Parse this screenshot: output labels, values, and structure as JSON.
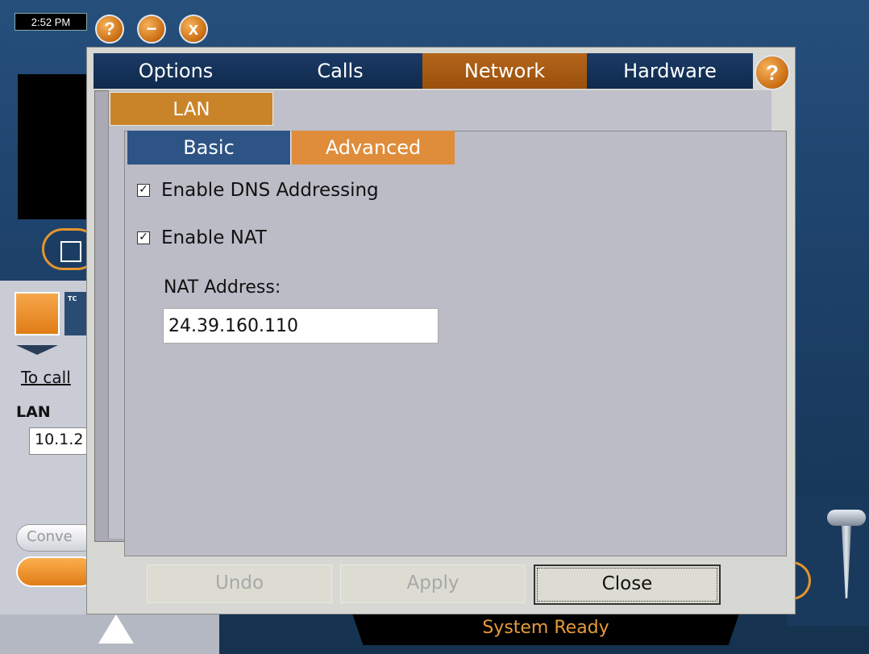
{
  "clock": "2:52 PM",
  "window_controls": {
    "help": "?",
    "minimize": "−",
    "close": "x"
  },
  "background": {
    "icon_tc": "TC",
    "to_call": "To call",
    "lan_label": "LAN",
    "ip_value": "10.1.2",
    "conve_btn": "Conve",
    "status": "System Ready"
  },
  "tabs": [
    "Options",
    "Calls",
    "Network",
    "Hardware"
  ],
  "active_tab": "Network",
  "help_button": "?",
  "section_tab": "LAN",
  "sub_tabs": [
    "Basic",
    "Advanced"
  ],
  "active_sub_tab": "Advanced",
  "options": {
    "dns": {
      "label": "Enable DNS Addressing",
      "checked": true
    },
    "nat": {
      "label": "Enable NAT",
      "checked": true
    }
  },
  "nat_address": {
    "label": "NAT Address:",
    "value": "24.39.160.110"
  },
  "buttons": {
    "undo": "Undo",
    "apply": "Apply",
    "close": "Close"
  },
  "colors": {
    "accent_orange": "#df8d3b",
    "active_tab": "#a8591a",
    "navy": "#10284a"
  }
}
